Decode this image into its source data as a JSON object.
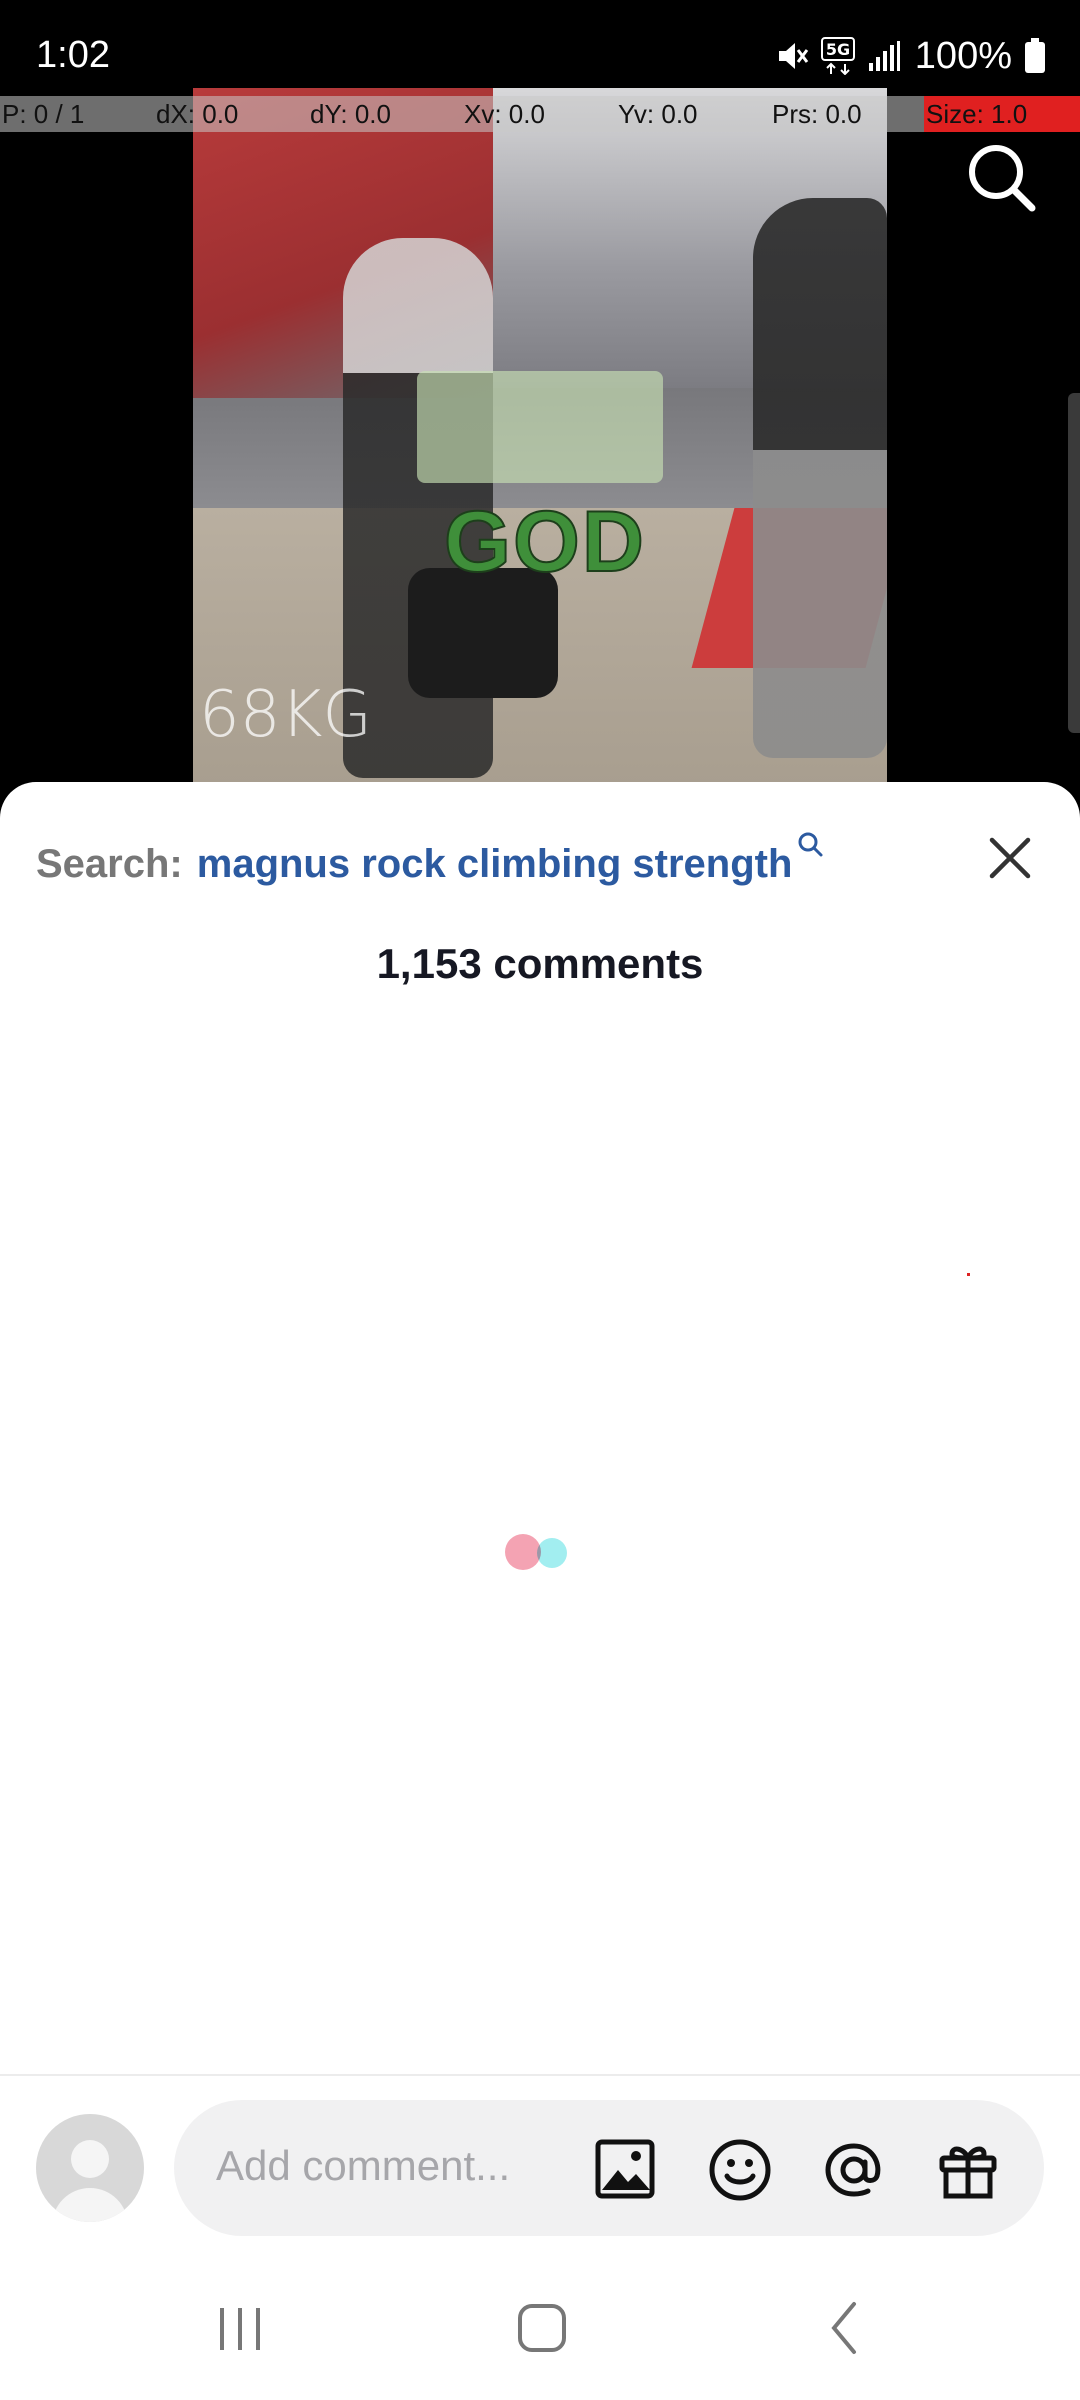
{
  "status_bar": {
    "time": "1:02",
    "battery_percent": "100%",
    "icons": [
      "mute-icon",
      "5g-icon",
      "signal-icon",
      "battery-icon"
    ]
  },
  "debug_overlay": {
    "pointer": "P: 0 / 1",
    "dx": "dX: 0.0",
    "dy": "dY: 0.0",
    "xv": "Xv: 0.0",
    "yv": "Yv: 0.0",
    "prs": "Prs: 0.0",
    "size": "Size: 1.0"
  },
  "video": {
    "overlay_caption": "GOD",
    "watermark": "68KG"
  },
  "comments_sheet": {
    "search_prefix": "Search:",
    "search_query": "magnus rock climbing strength",
    "comments_count": "1,153 comments"
  },
  "comment_input": {
    "placeholder": "Add comment..."
  },
  "colors": {
    "query_link": "#2c5aa0",
    "loader_pink": "#f4a3b3",
    "loader_cyan": "#a2eef0"
  }
}
